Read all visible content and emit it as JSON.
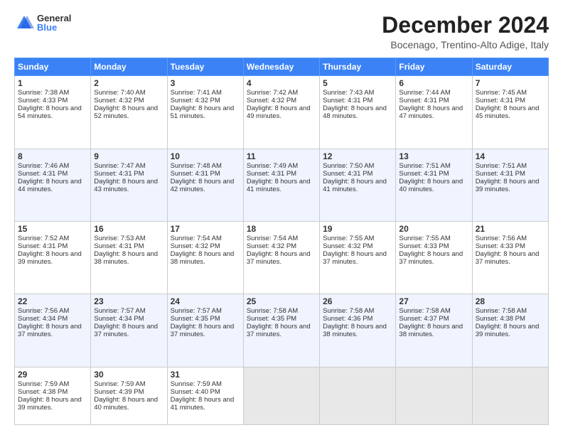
{
  "logo": {
    "general": "General",
    "blue": "Blue"
  },
  "header": {
    "title": "December 2024",
    "subtitle": "Bocenago, Trentino-Alto Adige, Italy"
  },
  "days": [
    "Sunday",
    "Monday",
    "Tuesday",
    "Wednesday",
    "Thursday",
    "Friday",
    "Saturday"
  ],
  "weeks": [
    [
      {
        "day": "1",
        "sunrise": "Sunrise: 7:38 AM",
        "sunset": "Sunset: 4:33 PM",
        "daylight": "Daylight: 8 hours and 54 minutes."
      },
      {
        "day": "2",
        "sunrise": "Sunrise: 7:40 AM",
        "sunset": "Sunset: 4:32 PM",
        "daylight": "Daylight: 8 hours and 52 minutes."
      },
      {
        "day": "3",
        "sunrise": "Sunrise: 7:41 AM",
        "sunset": "Sunset: 4:32 PM",
        "daylight": "Daylight: 8 hours and 51 minutes."
      },
      {
        "day": "4",
        "sunrise": "Sunrise: 7:42 AM",
        "sunset": "Sunset: 4:32 PM",
        "daylight": "Daylight: 8 hours and 49 minutes."
      },
      {
        "day": "5",
        "sunrise": "Sunrise: 7:43 AM",
        "sunset": "Sunset: 4:31 PM",
        "daylight": "Daylight: 8 hours and 48 minutes."
      },
      {
        "day": "6",
        "sunrise": "Sunrise: 7:44 AM",
        "sunset": "Sunset: 4:31 PM",
        "daylight": "Daylight: 8 hours and 47 minutes."
      },
      {
        "day": "7",
        "sunrise": "Sunrise: 7:45 AM",
        "sunset": "Sunset: 4:31 PM",
        "daylight": "Daylight: 8 hours and 45 minutes."
      }
    ],
    [
      {
        "day": "8",
        "sunrise": "Sunrise: 7:46 AM",
        "sunset": "Sunset: 4:31 PM",
        "daylight": "Daylight: 8 hours and 44 minutes."
      },
      {
        "day": "9",
        "sunrise": "Sunrise: 7:47 AM",
        "sunset": "Sunset: 4:31 PM",
        "daylight": "Daylight: 8 hours and 43 minutes."
      },
      {
        "day": "10",
        "sunrise": "Sunrise: 7:48 AM",
        "sunset": "Sunset: 4:31 PM",
        "daylight": "Daylight: 8 hours and 42 minutes."
      },
      {
        "day": "11",
        "sunrise": "Sunrise: 7:49 AM",
        "sunset": "Sunset: 4:31 PM",
        "daylight": "Daylight: 8 hours and 41 minutes."
      },
      {
        "day": "12",
        "sunrise": "Sunrise: 7:50 AM",
        "sunset": "Sunset: 4:31 PM",
        "daylight": "Daylight: 8 hours and 41 minutes."
      },
      {
        "day": "13",
        "sunrise": "Sunrise: 7:51 AM",
        "sunset": "Sunset: 4:31 PM",
        "daylight": "Daylight: 8 hours and 40 minutes."
      },
      {
        "day": "14",
        "sunrise": "Sunrise: 7:51 AM",
        "sunset": "Sunset: 4:31 PM",
        "daylight": "Daylight: 8 hours and 39 minutes."
      }
    ],
    [
      {
        "day": "15",
        "sunrise": "Sunrise: 7:52 AM",
        "sunset": "Sunset: 4:31 PM",
        "daylight": "Daylight: 8 hours and 39 minutes."
      },
      {
        "day": "16",
        "sunrise": "Sunrise: 7:53 AM",
        "sunset": "Sunset: 4:31 PM",
        "daylight": "Daylight: 8 hours and 38 minutes."
      },
      {
        "day": "17",
        "sunrise": "Sunrise: 7:54 AM",
        "sunset": "Sunset: 4:32 PM",
        "daylight": "Daylight: 8 hours and 38 minutes."
      },
      {
        "day": "18",
        "sunrise": "Sunrise: 7:54 AM",
        "sunset": "Sunset: 4:32 PM",
        "daylight": "Daylight: 8 hours and 37 minutes."
      },
      {
        "day": "19",
        "sunrise": "Sunrise: 7:55 AM",
        "sunset": "Sunset: 4:32 PM",
        "daylight": "Daylight: 8 hours and 37 minutes."
      },
      {
        "day": "20",
        "sunrise": "Sunrise: 7:55 AM",
        "sunset": "Sunset: 4:33 PM",
        "daylight": "Daylight: 8 hours and 37 minutes."
      },
      {
        "day": "21",
        "sunrise": "Sunrise: 7:56 AM",
        "sunset": "Sunset: 4:33 PM",
        "daylight": "Daylight: 8 hours and 37 minutes."
      }
    ],
    [
      {
        "day": "22",
        "sunrise": "Sunrise: 7:56 AM",
        "sunset": "Sunset: 4:34 PM",
        "daylight": "Daylight: 8 hours and 37 minutes."
      },
      {
        "day": "23",
        "sunrise": "Sunrise: 7:57 AM",
        "sunset": "Sunset: 4:34 PM",
        "daylight": "Daylight: 8 hours and 37 minutes."
      },
      {
        "day": "24",
        "sunrise": "Sunrise: 7:57 AM",
        "sunset": "Sunset: 4:35 PM",
        "daylight": "Daylight: 8 hours and 37 minutes."
      },
      {
        "day": "25",
        "sunrise": "Sunrise: 7:58 AM",
        "sunset": "Sunset: 4:35 PM",
        "daylight": "Daylight: 8 hours and 37 minutes."
      },
      {
        "day": "26",
        "sunrise": "Sunrise: 7:58 AM",
        "sunset": "Sunset: 4:36 PM",
        "daylight": "Daylight: 8 hours and 38 minutes."
      },
      {
        "day": "27",
        "sunrise": "Sunrise: 7:58 AM",
        "sunset": "Sunset: 4:37 PM",
        "daylight": "Daylight: 8 hours and 38 minutes."
      },
      {
        "day": "28",
        "sunrise": "Sunrise: 7:58 AM",
        "sunset": "Sunset: 4:38 PM",
        "daylight": "Daylight: 8 hours and 39 minutes."
      }
    ],
    [
      {
        "day": "29",
        "sunrise": "Sunrise: 7:59 AM",
        "sunset": "Sunset: 4:38 PM",
        "daylight": "Daylight: 8 hours and 39 minutes."
      },
      {
        "day": "30",
        "sunrise": "Sunrise: 7:59 AM",
        "sunset": "Sunset: 4:39 PM",
        "daylight": "Daylight: 8 hours and 40 minutes."
      },
      {
        "day": "31",
        "sunrise": "Sunrise: 7:59 AM",
        "sunset": "Sunset: 4:40 PM",
        "daylight": "Daylight: 8 hours and 41 minutes."
      },
      null,
      null,
      null,
      null
    ]
  ]
}
